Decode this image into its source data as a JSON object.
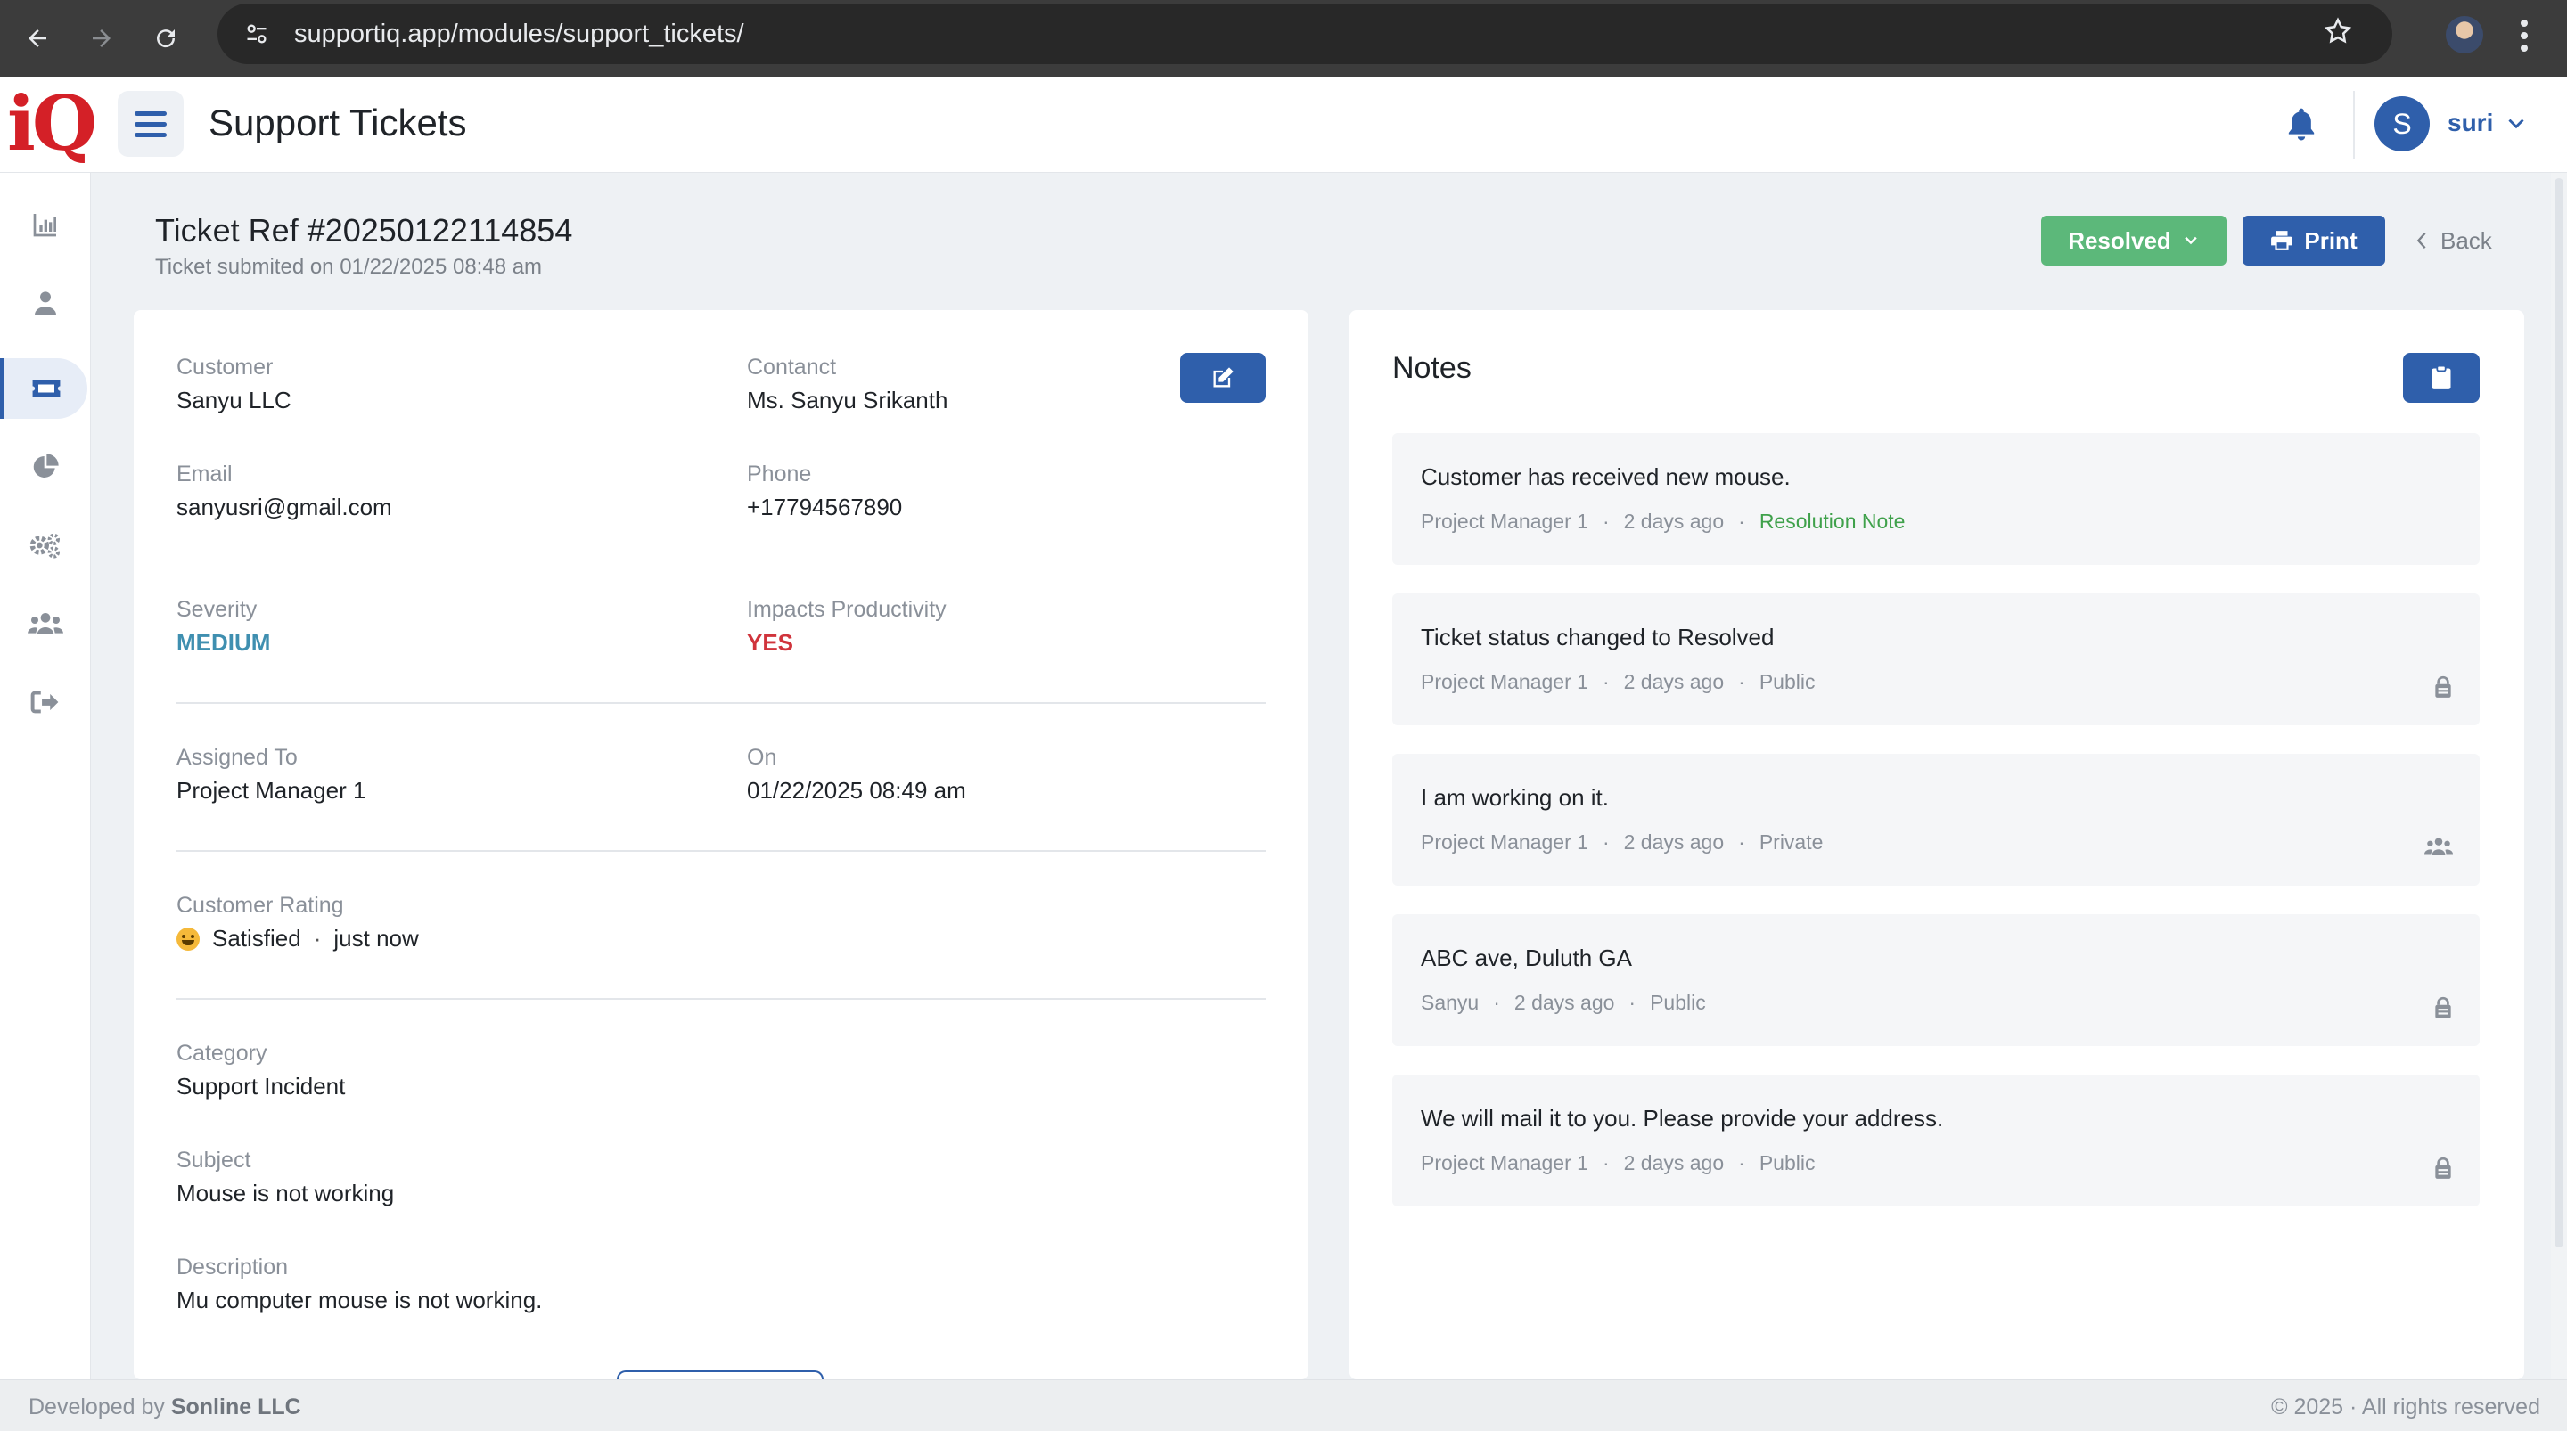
{
  "browser": {
    "url": "supportiq.app/modules/support_tickets/"
  },
  "header": {
    "logo": "iQ",
    "title": "Support Tickets",
    "user_initial": "S",
    "username": "suri"
  },
  "sidebar": {
    "items": [
      {
        "icon": "chart-icon"
      },
      {
        "icon": "user-icon"
      },
      {
        "icon": "ticket-icon",
        "active": true
      },
      {
        "icon": "pie-chart-icon"
      },
      {
        "icon": "gears-icon"
      },
      {
        "icon": "users-icon"
      },
      {
        "icon": "logout-icon"
      }
    ]
  },
  "ticket": {
    "title": "Ticket Ref #20250122114854",
    "submitted": "Ticket submited on 01/22/2025 08:48 am",
    "status_label": "Resolved",
    "print_label": "Print",
    "back_label": "Back"
  },
  "details": {
    "customer_label": "Customer",
    "customer": "Sanyu LLC",
    "contact_label": "Contanct",
    "contact": "Ms. Sanyu Srikanth",
    "email_label": "Email",
    "email": "sanyusri@gmail.com",
    "phone_label": "Phone",
    "phone": "+17794567890",
    "severity_label": "Severity",
    "severity": "MEDIUM",
    "impacts_label": "Impacts Productivity",
    "impacts": "YES",
    "assigned_label": "Assigned To",
    "assigned": "Project Manager 1",
    "on_label": "On",
    "on": "01/22/2025 08:49 am",
    "rating_label": "Customer Rating",
    "rating": "Satisfied",
    "rating_sep": "·",
    "rating_time": "just now",
    "category_label": "Category",
    "category": "Support Incident",
    "subject_label": "Subject",
    "subject": "Mouse is not working",
    "description_label": "Description",
    "description": "Mu computer mouse is not working."
  },
  "notes": {
    "title": "Notes",
    "items": [
      {
        "text": "Customer has received new mouse.",
        "author": "Project Manager 1",
        "time": "2 days ago",
        "visibility": "Resolution Note",
        "sep": "·",
        "icon": ""
      },
      {
        "text": "Ticket status changed to Resolved",
        "author": "Project Manager 1",
        "time": "2 days ago",
        "visibility": "Public",
        "sep": "·",
        "icon": "public-icon"
      },
      {
        "text": "I am working on it.",
        "author": "Project Manager 1",
        "time": "2 days ago",
        "visibility": "Private",
        "sep": "·",
        "icon": "team-icon"
      },
      {
        "text": "ABC ave, Duluth GA",
        "author": "Sanyu",
        "time": "2 days ago",
        "visibility": "Public",
        "sep": "·",
        "icon": "public-icon"
      },
      {
        "text": "We will mail it to you. Please provide your address.",
        "author": "Project Manager 1",
        "time": "2 days ago",
        "visibility": "Public",
        "sep": "·",
        "icon": "public-icon"
      }
    ]
  },
  "footer": {
    "developed_prefix": "Developed by",
    "developer": "Sonline LLC",
    "copyright": "© 2025 · All rights reserved"
  },
  "colors": {
    "primary": "#2f5fab",
    "success": "#5cb87a",
    "danger": "#d0343c",
    "info": "#3f8fb0"
  }
}
